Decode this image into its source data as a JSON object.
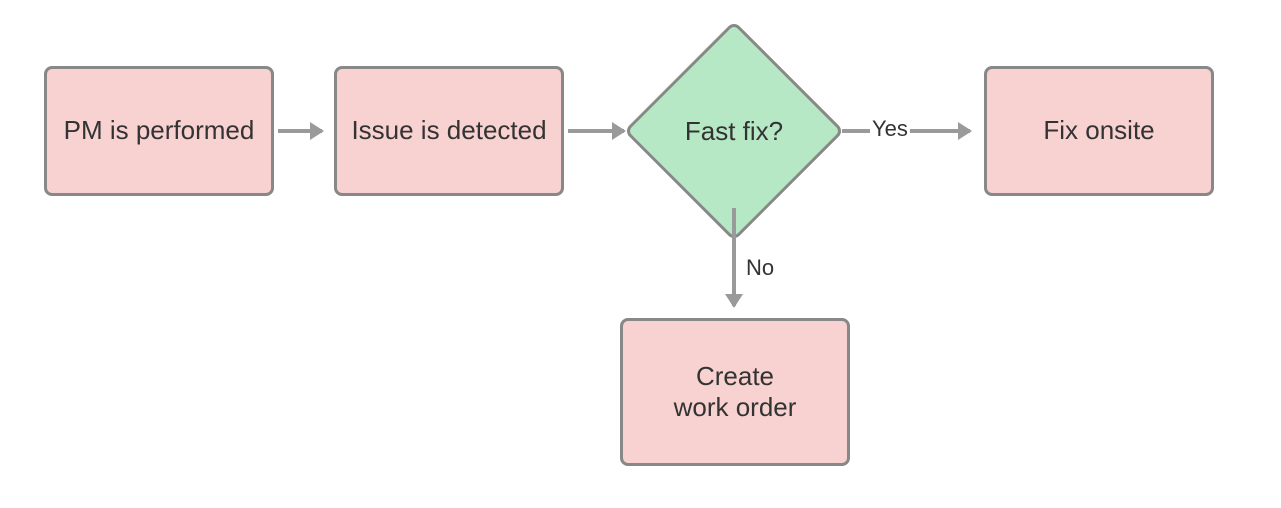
{
  "nodes": {
    "pm": {
      "label": "PM is performed"
    },
    "issue": {
      "label": "Issue is detected"
    },
    "decision": {
      "label": "Fast fix?"
    },
    "fix": {
      "label": "Fix onsite"
    },
    "workorder": {
      "label_line1": "Create",
      "label_line2": "work order"
    }
  },
  "edges": {
    "yes": {
      "label": "Yes"
    },
    "no": {
      "label": "No"
    }
  },
  "colors": {
    "process_fill": "#f8d1d1",
    "decision_fill": "#b6e8c5",
    "border": "#888888",
    "arrow": "#9a9a9a",
    "text": "#333333"
  }
}
